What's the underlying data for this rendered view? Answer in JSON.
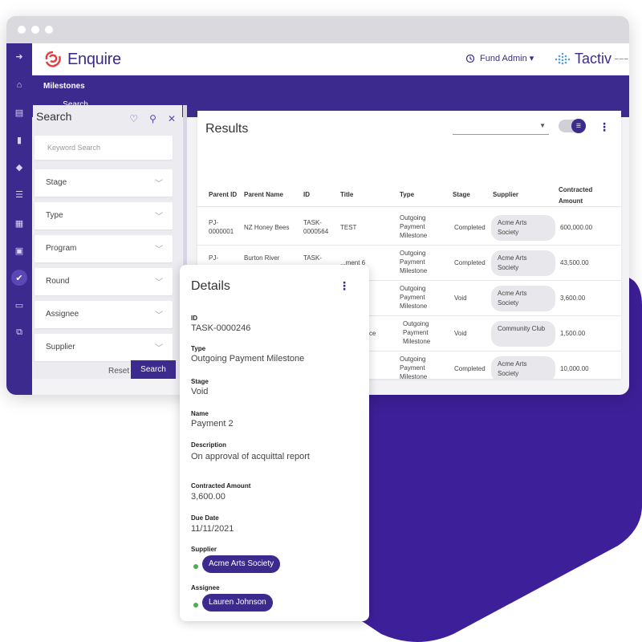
{
  "brand": {
    "app_name": "Enquire",
    "partner_name": "Tactiv",
    "accent": "#3d2a8e",
    "window_dots": 3
  },
  "topbar": {
    "user_menu": "Fund Admin ▾"
  },
  "header": {
    "title": "Milestones",
    "tab": "Search"
  },
  "search_panel": {
    "title": "Search",
    "keyword_placeholder": "Keyword Search",
    "filters": [
      "Stage",
      "Type",
      "Program",
      "Round",
      "Assignee",
      "Supplier"
    ],
    "reset_label": "Reset",
    "search_label": "Search"
  },
  "results": {
    "title": "Results",
    "columns": [
      "Parent ID",
      "Parent Name",
      "ID",
      "Title",
      "Type",
      "Stage",
      "Supplier",
      "Contracted Amount"
    ],
    "rows": [
      {
        "parent_id": "PJ-0000001",
        "parent_name": "NZ Honey Bees",
        "id": "TASK-0000564",
        "title": "TEST",
        "type": "Outgoing Payment Milestone",
        "stage": "Completed",
        "supplier": "Acme Arts Society",
        "amount": "600,000.00"
      },
      {
        "parent_id": "PJ-",
        "parent_name": "Burton River",
        "id": "TASK-",
        "title": "...ment 6",
        "type": "Outgoing Payment Milestone",
        "stage": "Completed",
        "supplier": "Acme Arts Society",
        "amount": "43,500.00"
      },
      {
        "parent_id": "",
        "parent_name": "",
        "id": "",
        "title": "...nt 2",
        "type": "Outgoing Payment Milestone",
        "stage": "Void",
        "supplier": "Acme Arts Society",
        "amount": "3,600.00"
      },
      {
        "parent_id": "",
        "parent_name": "",
        "id": "",
        "title": "...als Invoice",
        "type": "Outgoing Payment Milestone",
        "stage": "Void",
        "supplier": "Community Club",
        "amount": "1,500.00"
      },
      {
        "parent_id": "",
        "parent_name": "",
        "id": "",
        "title": "...ayment",
        "type": "Outgoing Payment Milestone",
        "stage": "Completed",
        "supplier": "Acme Arts Society",
        "amount": "10,000.00"
      }
    ]
  },
  "details": {
    "title": "Details",
    "id_label": "ID",
    "id": "TASK-0000246",
    "type_label": "Type",
    "type": "Outgoing Payment Milestone",
    "stage_label": "Stage",
    "stage": "Void",
    "name_label": "Name",
    "name": "Payment 2",
    "description_label": "Description",
    "description": "On approval of acquittal report",
    "amount_label": "Contracted Amount",
    "amount": "3,600.00",
    "due_label": "Due Date",
    "due": "11/11/2021",
    "supplier_label": "Supplier",
    "supplier": "Acme Arts Society",
    "assignee_label": "Assignee",
    "assignee": "Lauren Johnson"
  }
}
